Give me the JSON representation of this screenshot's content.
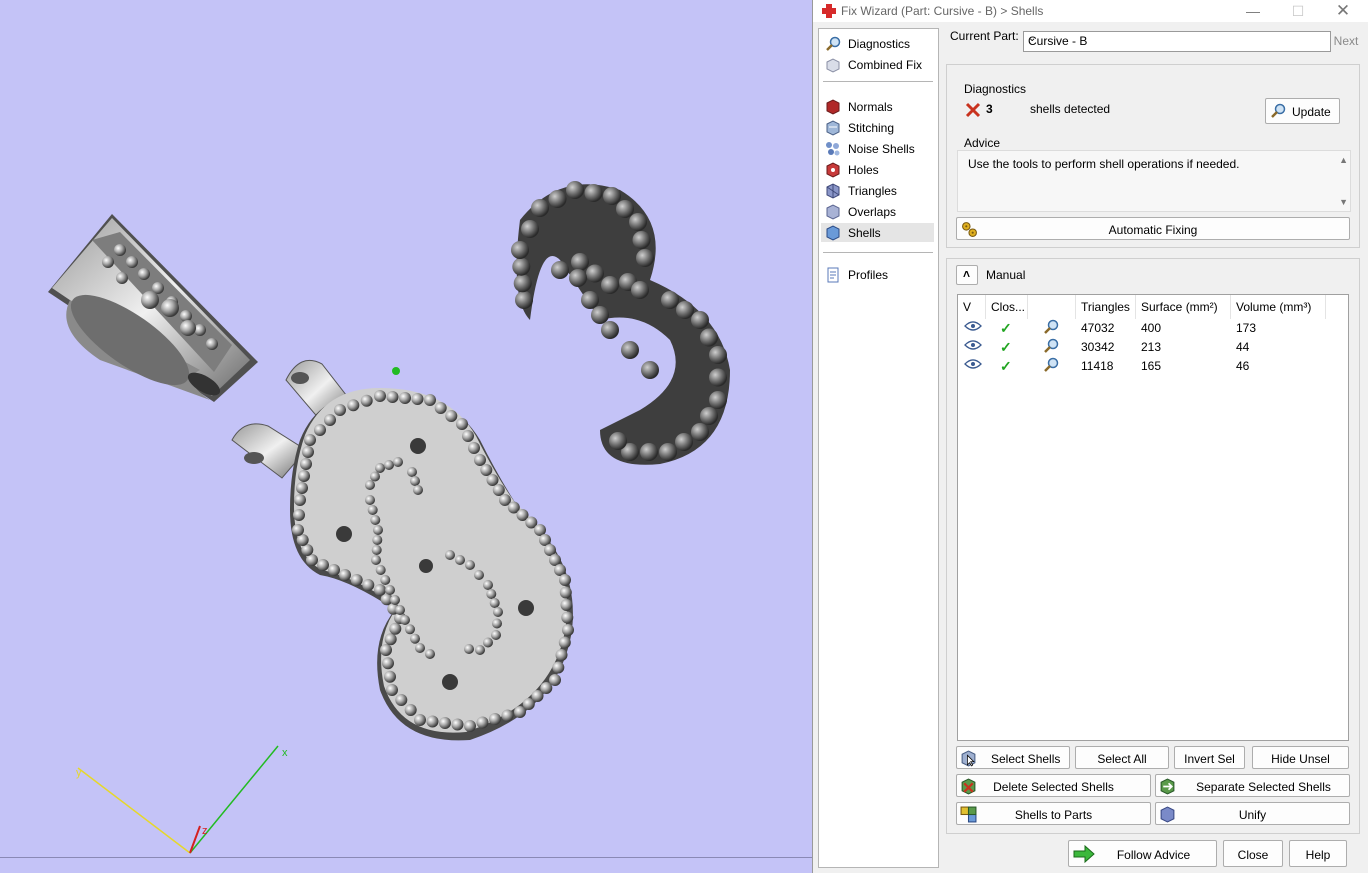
{
  "window": {
    "title": "Fix Wizard (Part: Cursive - B) > Shells",
    "controls": [
      "minimize-icon",
      "maximize-icon",
      "close-icon"
    ]
  },
  "nav": {
    "group1": [
      {
        "label": "Diagnostics",
        "icon": "magnifier-icon"
      },
      {
        "label": "Combined Fix",
        "icon": "cube-icon"
      }
    ],
    "group2": [
      {
        "label": "Normals",
        "icon": "normals-icon"
      },
      {
        "label": "Stitching",
        "icon": "stitching-icon"
      },
      {
        "label": "Noise Shells",
        "icon": "noise-shells-icon"
      },
      {
        "label": "Holes",
        "icon": "holes-icon"
      },
      {
        "label": "Triangles",
        "icon": "triangles-icon"
      },
      {
        "label": "Overlaps",
        "icon": "overlaps-icon"
      },
      {
        "label": "Shells",
        "icon": "shells-icon",
        "selected": true
      }
    ],
    "group3": [
      {
        "label": "Profiles",
        "icon": "profiles-icon"
      }
    ]
  },
  "current_part": {
    "label": "Current Part:",
    "value": "Cursive - B",
    "next_label": "Next"
  },
  "diagnostics": {
    "title": "Diagnostics",
    "count": "3",
    "status_text": "shells detected",
    "update_label": "Update",
    "advice_title": "Advice",
    "advice_text": "Use the tools to perform shell operations if needed.",
    "auto_fix_label": "Automatic Fixing"
  },
  "manual": {
    "title": "Manual",
    "columns": [
      "V",
      "Clos...",
      "",
      "Triangles",
      "Surface (mm²)",
      "Volume (mm³)"
    ],
    "rows": [
      {
        "triangles": "47032",
        "surface": "400",
        "volume": "173"
      },
      {
        "triangles": "30342",
        "surface": "213",
        "volume": "44"
      },
      {
        "triangles": "11418",
        "surface": "165",
        "volume": "46"
      }
    ],
    "buttons": {
      "select_shells": "Select Shells",
      "select_all": "Select All",
      "invert_sel": "Invert Sel",
      "hide_unsel": "Hide Unsel",
      "delete_selected": "Delete Selected Shells",
      "separate_selected": "Separate Selected Shells",
      "shells_to_parts": "Shells to Parts",
      "unify": "Unify"
    }
  },
  "footer": {
    "follow_advice": "Follow Advice",
    "close": "Close",
    "help": "Help"
  },
  "viewport": {
    "axes": [
      "x",
      "y",
      "z"
    ],
    "colors": {
      "background": "#c4c3f7",
      "x_axis": "#22bb22",
      "y_axis": "#e6d82a",
      "z_axis": "#d42020"
    }
  }
}
